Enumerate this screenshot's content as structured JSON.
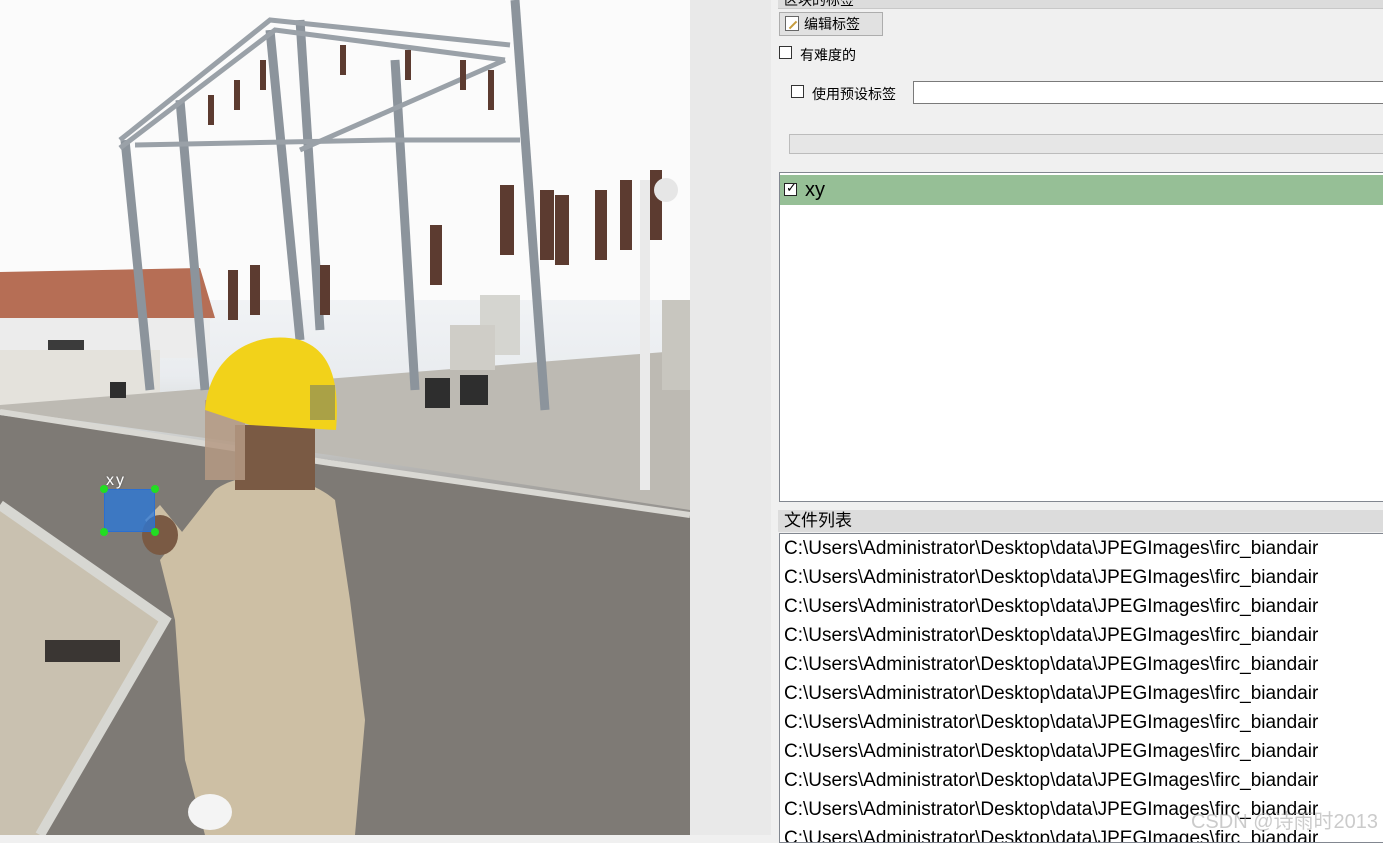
{
  "canvas": {
    "annotation_label": "xy",
    "annotation_color": "#2878dc",
    "handle_color": "#22dd22"
  },
  "dock": {
    "top_title": "区块的标签",
    "edit_label_button": "编辑标签",
    "difficult_label": "有难度的",
    "use_preset_label": "使用预设标签",
    "preset_value": "",
    "labels": [
      {
        "text": "xy",
        "checked": true,
        "color": "#96bf96"
      }
    ]
  },
  "file_dock": {
    "title": "文件列表",
    "files": [
      "C:\\Users\\Administrator\\Desktop\\data\\JPEGImages\\firc_biandair",
      "C:\\Users\\Administrator\\Desktop\\data\\JPEGImages\\firc_biandair",
      "C:\\Users\\Administrator\\Desktop\\data\\JPEGImages\\firc_biandair",
      "C:\\Users\\Administrator\\Desktop\\data\\JPEGImages\\firc_biandair",
      "C:\\Users\\Administrator\\Desktop\\data\\JPEGImages\\firc_biandair",
      "C:\\Users\\Administrator\\Desktop\\data\\JPEGImages\\firc_biandair",
      "C:\\Users\\Administrator\\Desktop\\data\\JPEGImages\\firc_biandair",
      "C:\\Users\\Administrator\\Desktop\\data\\JPEGImages\\firc_biandair",
      "C:\\Users\\Administrator\\Desktop\\data\\JPEGImages\\firc_biandair",
      "C:\\Users\\Administrator\\Desktop\\data\\JPEGImages\\firc_biandair",
      "C:\\Users\\Administrator\\Desktop\\data\\JPEGImages\\firc_biandair"
    ],
    "watermark": "CSDN @诗雨时2013"
  }
}
